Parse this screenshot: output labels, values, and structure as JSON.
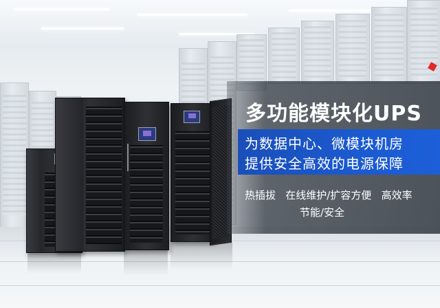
{
  "banner": {
    "title": "多功能模块化UPS",
    "tagline_line1": "为数据中心、微模块机房",
    "tagline_line2": "提供安全高效的电源保障",
    "features_line1": "热插拔   在线维护/扩容方便   高效率",
    "features_line2": "节能/安全"
  },
  "colors": {
    "band_blue": "#1b5ad0",
    "overlay_dark": "#373d45",
    "cabinet_black": "#1f2023",
    "screen_blue": "#2b3c7c",
    "accent_red": "#e02828"
  },
  "icons": {
    "red_marker": "red-diamond-icon"
  }
}
